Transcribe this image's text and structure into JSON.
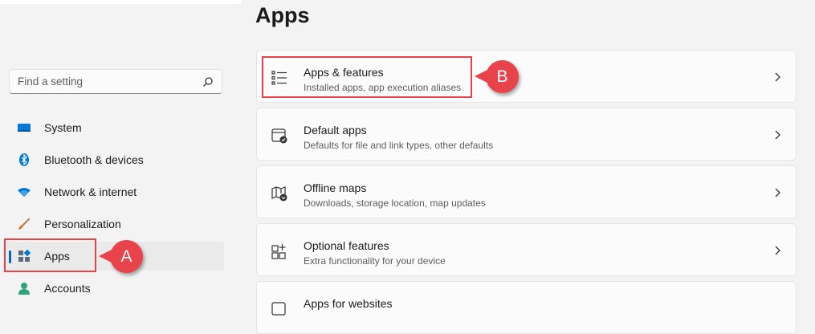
{
  "sidebar": {
    "search_placeholder": "Find a setting",
    "items": [
      {
        "label": "System",
        "icon": "monitor-icon"
      },
      {
        "label": "Bluetooth & devices",
        "icon": "bluetooth-icon"
      },
      {
        "label": "Network & internet",
        "icon": "wifi-icon"
      },
      {
        "label": "Personalization",
        "icon": "brush-icon"
      },
      {
        "label": "Apps",
        "icon": "apps-icon",
        "active": true
      },
      {
        "label": "Accounts",
        "icon": "person-icon"
      }
    ]
  },
  "main": {
    "title": "Apps",
    "cards": [
      {
        "title": "Apps & features",
        "subtitle": "Installed apps, app execution aliases",
        "icon": "list-icon"
      },
      {
        "title": "Default apps",
        "subtitle": "Defaults for file and link types, other defaults",
        "icon": "default-apps-icon"
      },
      {
        "title": "Offline maps",
        "subtitle": "Downloads, storage location, map updates",
        "icon": "map-icon"
      },
      {
        "title": "Optional features",
        "subtitle": "Extra functionality for your device",
        "icon": "optional-features-icon"
      },
      {
        "title": "Apps for websites",
        "subtitle": "",
        "icon": "apps-websites-icon"
      }
    ]
  },
  "callouts": {
    "a": "A",
    "b": "B"
  },
  "colors": {
    "accent": "#0067c0",
    "callout": "#e8424a",
    "background": "#f3f3f3",
    "card": "#fbfbfb"
  }
}
